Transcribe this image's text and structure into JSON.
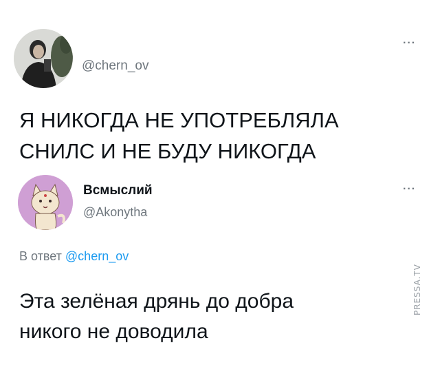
{
  "tweet1": {
    "handle": "@chern_ov",
    "more": "···",
    "text_line1": "Я НИКОГДА НЕ УПОТРЕБЛЯЛА",
    "text_line2": "СНИЛС И НЕ БУДУ НИКОГДА"
  },
  "tweet2": {
    "name": "Всмыслий",
    "handle": "@Akonytha",
    "more": "···",
    "reply_prefix": "В ответ",
    "reply_mention": "@chern_ov",
    "text_line1": "Эта зелёная дрянь до добра",
    "text_line2": "никого не доводила"
  },
  "watermark": "PRESSA.TV",
  "colors": {
    "text": "#0f1419",
    "secondary": "#6e767d",
    "mention": "#1d9bf0"
  }
}
